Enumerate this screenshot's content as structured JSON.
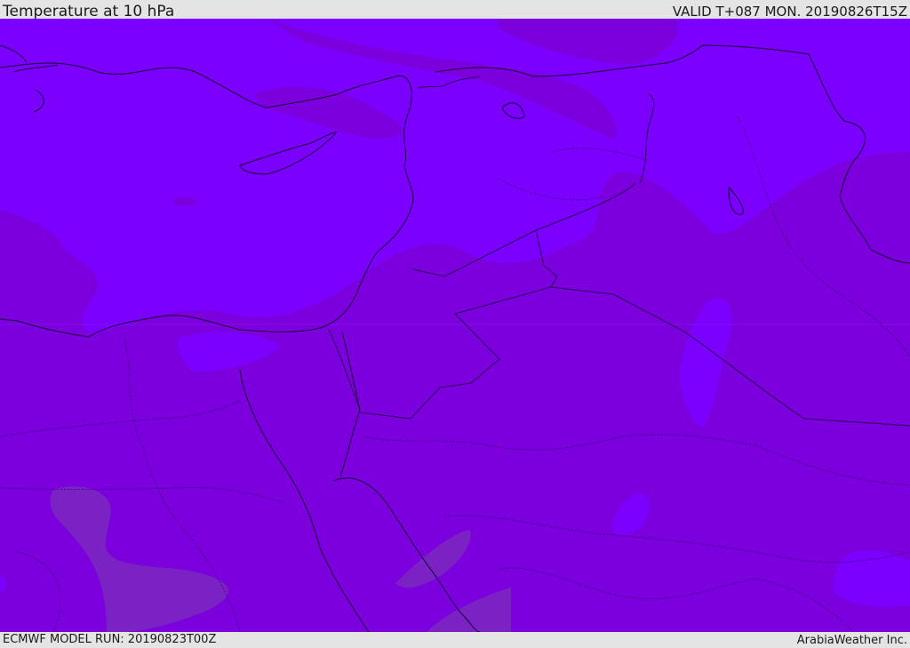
{
  "header": {
    "title": "Temperature at 10 hPa",
    "valid_time": "VALID T+087 MON. 20190826T15Z"
  },
  "footer": {
    "model_run": "ECMWF MODEL RUN: 20190823T00Z",
    "credit": "ArabiaWeather Inc."
  },
  "map": {
    "variable": "temperature",
    "level": "10 hPa",
    "colors": {
      "warm_band": "#7b00ff",
      "mid_band": "#7c00dd",
      "cold_band": "#7a22c4",
      "coastline": "#1a0033",
      "border_line": "#2a0055"
    }
  }
}
